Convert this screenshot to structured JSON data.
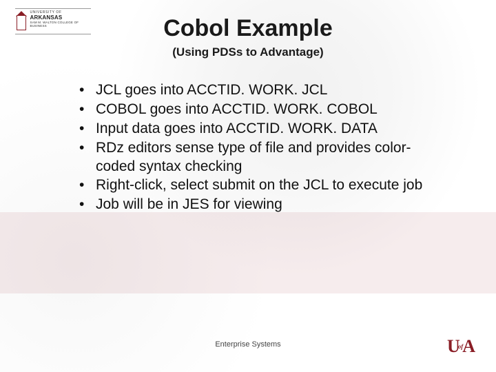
{
  "logo_top": {
    "line1": "UNIVERSITY OF",
    "line2": "ARKANSAS",
    "line3": "SAM M. WALTON COLLEGE OF BUSINESS"
  },
  "title": "Cobol Example",
  "subtitle": "(Using PDSs to Advantage)",
  "bullets": [
    "JCL goes into ACCTID. WORK. JCL",
    "COBOL goes into ACCTID. WORK. COBOL",
    "Input data goes into ACCTID. WORK. DATA",
    "RDz editors sense type of file and provides color-coded syntax checking",
    "Right-click, select submit on the JCL to execute job",
    "Job will be in JES for viewing"
  ],
  "footer": "Enterprise Systems",
  "logo_bottom": {
    "left": "U",
    "mid": "of",
    "right": "A"
  }
}
